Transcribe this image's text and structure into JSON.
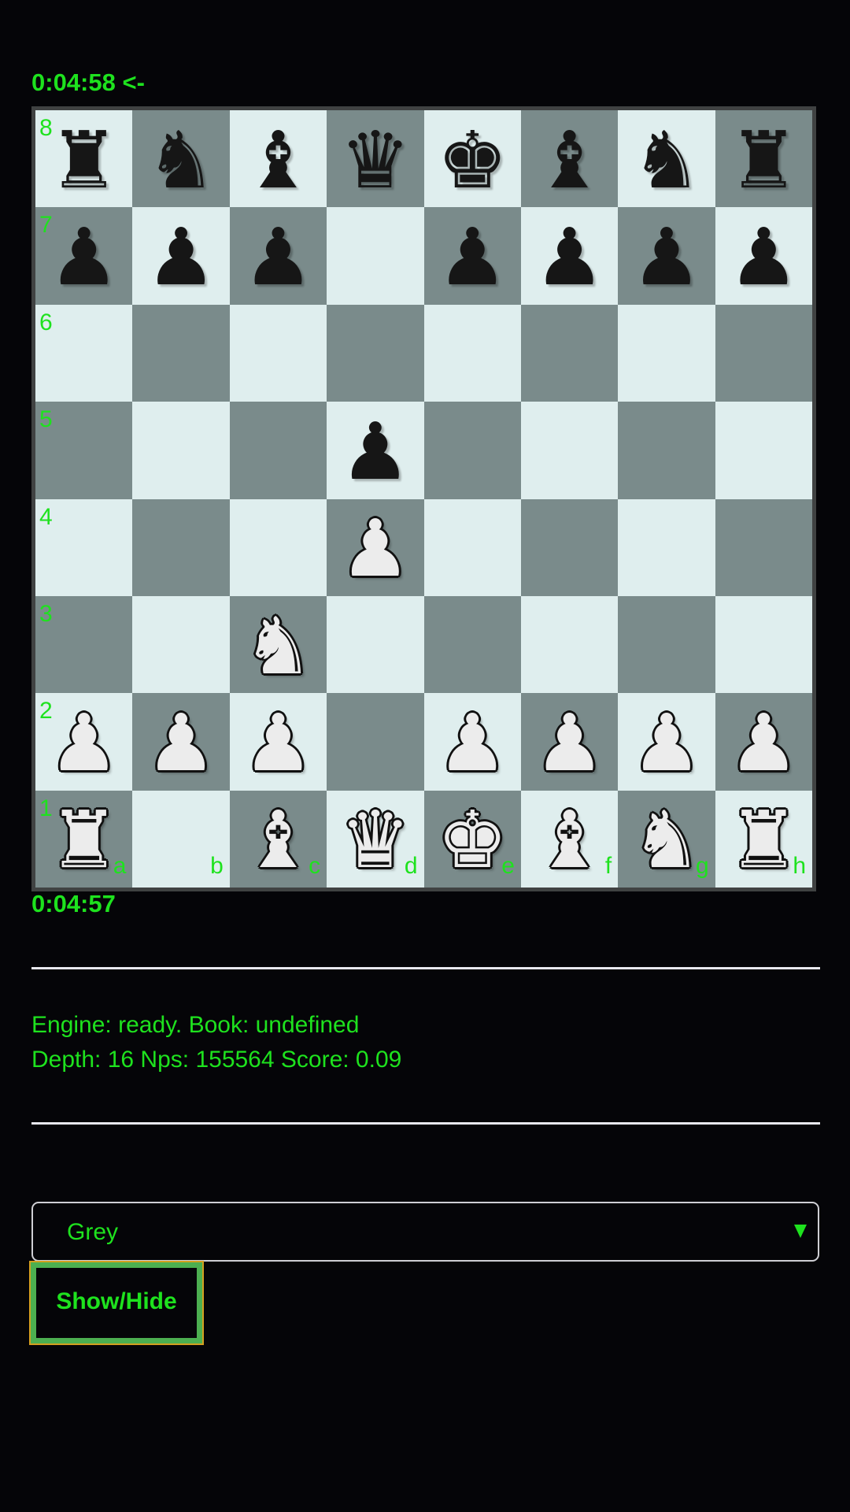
{
  "clocks": {
    "top": "0:04:58 <-",
    "bottom": "0:04:57"
  },
  "board": {
    "ranks": [
      "8",
      "7",
      "6",
      "5",
      "4",
      "3",
      "2",
      "1"
    ],
    "files": [
      "a",
      "b",
      "c",
      "d",
      "e",
      "f",
      "g",
      "h"
    ],
    "position": [
      [
        "bR",
        "bN",
        "bB",
        "bQ",
        "bK",
        "bB",
        "bN",
        "bR"
      ],
      [
        "bP",
        "bP",
        "bP",
        "",
        "bP",
        "bP",
        "bP",
        "bP"
      ],
      [
        "",
        "",
        "",
        "",
        "",
        "",
        "",
        ""
      ],
      [
        "",
        "",
        "",
        "bP",
        "",
        "",
        "",
        ""
      ],
      [
        "",
        "",
        "",
        "wP",
        "",
        "",
        "",
        ""
      ],
      [
        "",
        "",
        "wN",
        "",
        "",
        "",
        "",
        ""
      ],
      [
        "wP",
        "wP",
        "wP",
        "",
        "wP",
        "wP",
        "wP",
        "wP"
      ],
      [
        "wR",
        "",
        "wB",
        "wQ",
        "wK",
        "wB",
        "wN",
        "wR"
      ]
    ],
    "piece_glyphs": {
      "K": "♚",
      "Q": "♛",
      "R": "♜",
      "B": "♝",
      "N": "♞",
      "P": "♟"
    },
    "piece_names": {
      "K": "king",
      "Q": "queen",
      "R": "rook",
      "B": "bishop",
      "N": "knight",
      "P": "pawn"
    },
    "colors": {
      "light_square": "#dfeeee",
      "dark_square": "#7a8b8b",
      "label": "#1ee21e"
    }
  },
  "engine": {
    "status": "Engine: ready. Book: undefined",
    "stats": "Depth: 16 Nps: 155564 Score: 0.09"
  },
  "theme_select": {
    "selected": "Grey",
    "arrow_icon": "▼"
  },
  "buttons": {
    "show_hide": "Show/Hide"
  }
}
